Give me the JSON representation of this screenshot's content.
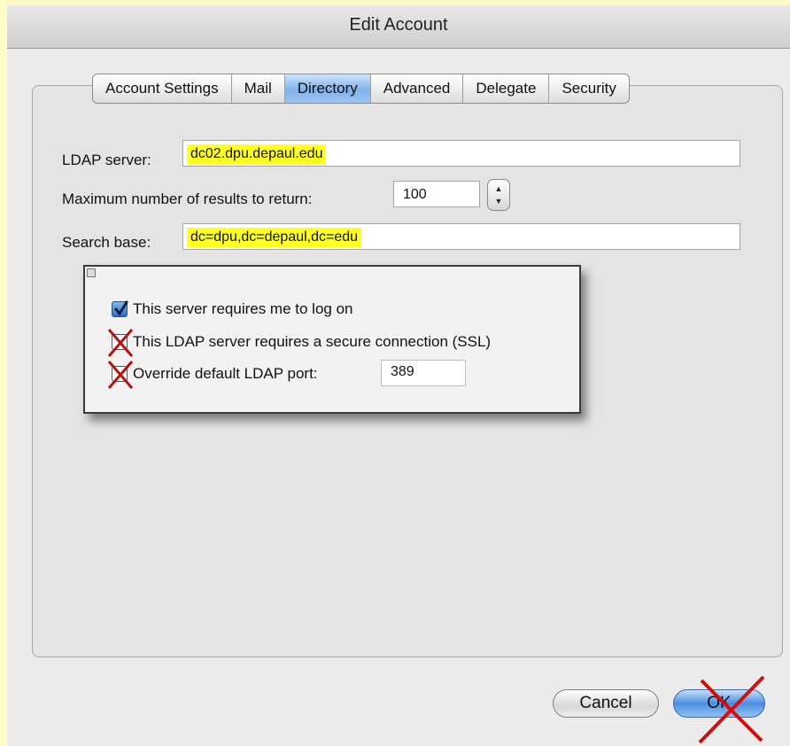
{
  "window": {
    "title": "Edit Account"
  },
  "tabs": [
    {
      "label": "Account Settings"
    },
    {
      "label": "Mail"
    },
    {
      "label": "Directory"
    },
    {
      "label": "Advanced"
    },
    {
      "label": "Delegate"
    },
    {
      "label": "Security"
    }
  ],
  "active_tab": "Directory",
  "form": {
    "ldap_label": "LDAP server:",
    "ldap_value": "dc02.dpu.depaul.edu",
    "max_label": "Maximum number of results to return:",
    "max_value": "100",
    "search_label": "Search base:",
    "search_value": "dc=dpu,dc=depaul,dc=edu"
  },
  "options": {
    "logon_label": "This server requires me to log on",
    "logon_checked": true,
    "ssl_label": "This LDAP server requires a secure connection (SSL)",
    "ssl_checked": false,
    "port_label": "Override default LDAP port:",
    "port_checked": false,
    "port_value": "389"
  },
  "buttons": {
    "cancel": "Cancel",
    "ok": "OK"
  },
  "colors": {
    "highlight": "#ffff22",
    "cross_mark": "#cc1111",
    "accent_blue": "#4c8fe0"
  }
}
